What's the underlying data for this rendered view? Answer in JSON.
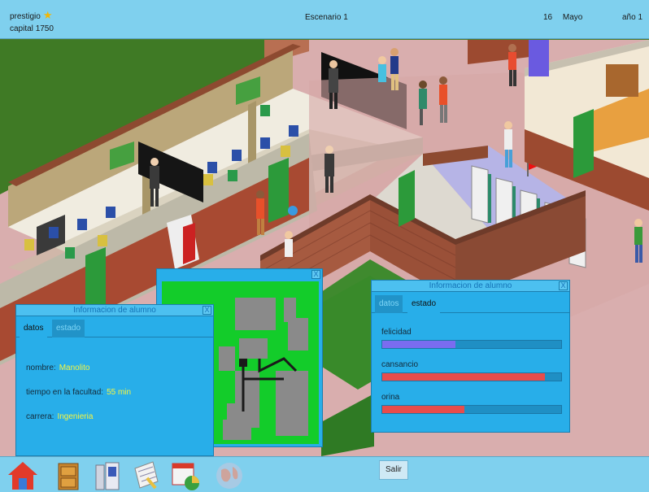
{
  "topbar": {
    "prestige_label": "prestigio",
    "capital_label": "capital",
    "capital_value": "1750",
    "scenario": "Escenario 1",
    "day": "16",
    "month": "Mayo",
    "year": "año 1"
  },
  "left_panel": {
    "title": "Informacion de alumno",
    "close": "X",
    "tabs": [
      "datos",
      "estado"
    ],
    "active_tab": "datos",
    "fields": {
      "name_label": "nombre:",
      "name_value": "Manolito",
      "time_label": "tiempo en la facultad:",
      "time_value": "55 min",
      "career_label": "carrera:",
      "career_value": "Ingenieria"
    }
  },
  "right_panel": {
    "title": "Informacion de alumno",
    "close": "X",
    "tabs": [
      "datos",
      "estado"
    ],
    "active_tab": "estado",
    "bars": [
      {
        "label": "felicidad",
        "value": 0.41,
        "color": "#7a6cf0"
      },
      {
        "label": "cansancio",
        "value": 0.91,
        "color": "#e84c4c"
      },
      {
        "label": "orina",
        "value": 0.46,
        "color": "#e84c4c"
      }
    ]
  },
  "minimap": {
    "close": "X"
  },
  "bottombar": {
    "exit_label": "Salir",
    "tools": [
      "home-icon",
      "cabinet-icon",
      "locker-icon",
      "notepad-icon",
      "calendar-chart-icon",
      "globe-icon"
    ]
  },
  "colors": {
    "ui_blue": "#7fd0ee",
    "panel_blue": "#28aee9",
    "value_yellow": "#f5f542",
    "star": "#f2b705"
  }
}
